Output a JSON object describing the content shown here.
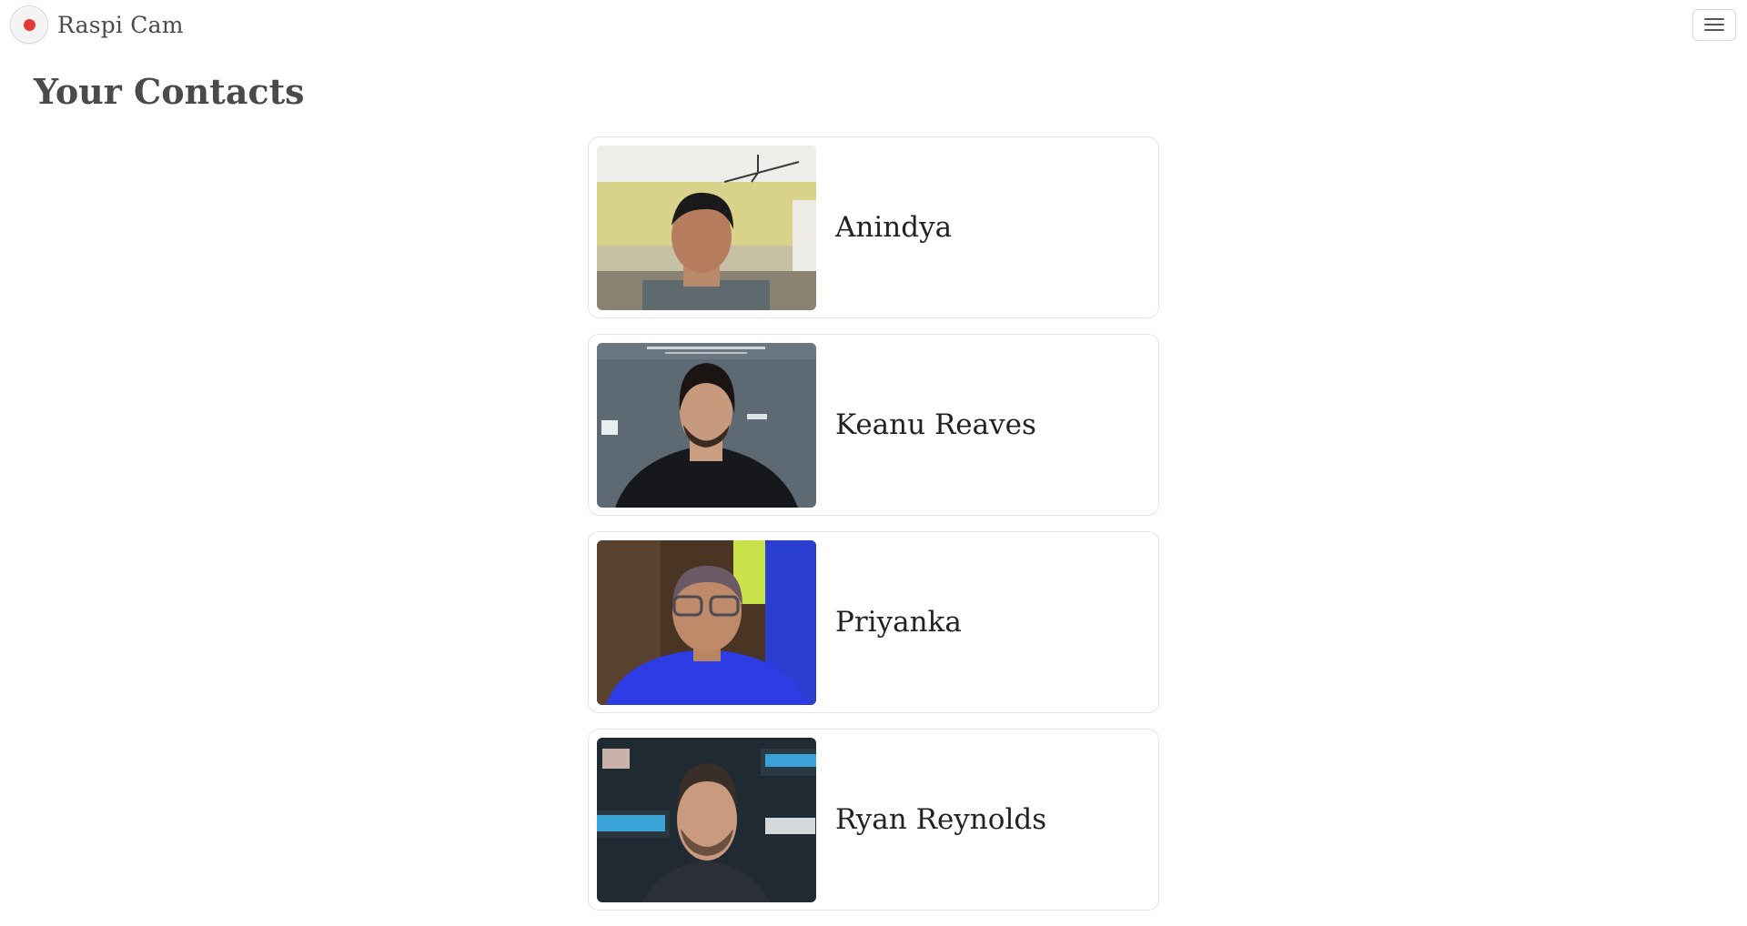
{
  "app": {
    "brand_name": "Raspi Cam",
    "brand_icon": "record-dot-icon",
    "accent_color": "#e53935",
    "menu_icon": "hamburger-menu-icon"
  },
  "page": {
    "title": "Your Contacts"
  },
  "contacts": [
    {
      "name": "Anindya",
      "photo": "person-photo-classroom"
    },
    {
      "name": "Keanu Reaves",
      "photo": "person-photo-press-event"
    },
    {
      "name": "Priyanka",
      "photo": "person-photo-webcam"
    },
    {
      "name": "Ryan Reynolds",
      "photo": "person-photo-press-event"
    }
  ]
}
